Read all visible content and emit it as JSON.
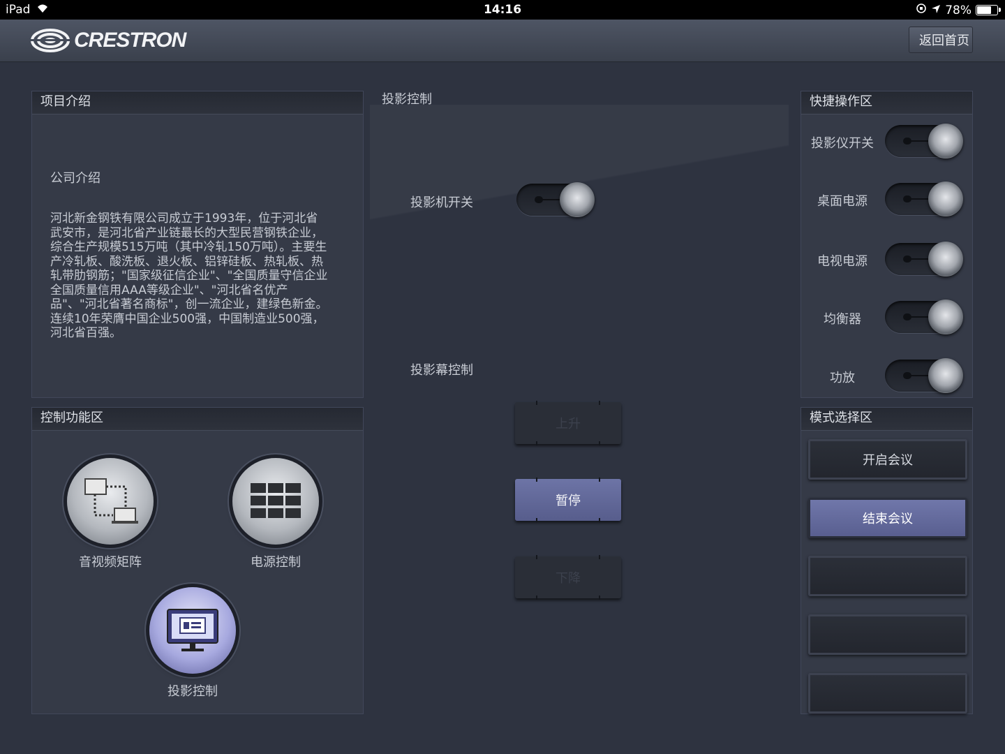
{
  "status_bar": {
    "device": "iPad",
    "time": "14:16",
    "battery": "78%",
    "battery_level": 0.78
  },
  "header": {
    "brand": "CRESTRON",
    "back_label": "返回首页"
  },
  "intro_panel": {
    "title": "项目介绍",
    "heading": "公司介绍",
    "body": "河北新金钢铁有限公司成立于1993年，位于河北省武安市，是河北省产业链最长的大型民营钢铁企业，综合生产规模515万吨（其中冷轧150万吨）。主要生产冷轧板、酸洗板、退火板、铝锌硅板、热轧板、热轧带肋钢筋；\"国家级征信企业\"、\"全国质量守信企业全国质量信用AAA等级企业\"、\"河北省名优产品\"、\"河北省著名商标\"，创一流企业，建绿色新金。连续10年荣膺中国企业500强，中国制造业500强，河北省百强。"
  },
  "control_panel": {
    "title": "控制功能区",
    "buttons": [
      {
        "label": "音视频矩阵",
        "icon": "av-matrix-icon"
      },
      {
        "label": "电源控制",
        "icon": "power-grid-icon"
      },
      {
        "label": "投影控制",
        "icon": "projector-screen-icon"
      }
    ]
  },
  "center": {
    "title": "投影控制",
    "projector_power_label": "投影机开关",
    "screen_control_label": "投影幕控制",
    "screen_buttons": [
      {
        "label": "上升"
      },
      {
        "label": "暂停"
      },
      {
        "label": "下降"
      }
    ]
  },
  "quick_panel": {
    "title": "快捷操作区",
    "items": [
      {
        "label": "投影仪开关"
      },
      {
        "label": "桌面电源"
      },
      {
        "label": "电视电源"
      },
      {
        "label": "均衡器"
      },
      {
        "label": "功放"
      }
    ]
  },
  "mode_panel": {
    "title": "模式选择区",
    "buttons": [
      {
        "label": "开启会议"
      },
      {
        "label": "结束会议"
      },
      {
        "label": ""
      },
      {
        "label": ""
      },
      {
        "label": ""
      }
    ]
  },
  "colors": {
    "background": "#2e3340",
    "accent": "#6d74a6",
    "panel": "#353a47"
  }
}
